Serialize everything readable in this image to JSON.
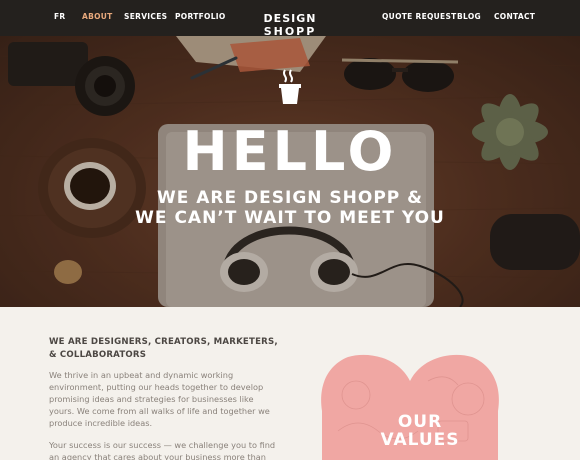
{
  "nav": {
    "left_items": [
      {
        "label": "FR",
        "active": false
      },
      {
        "label": "ABOUT",
        "active": true
      },
      {
        "label": "SERVICES",
        "active": false
      },
      {
        "label": "PORTFOLIO",
        "active": false
      }
    ],
    "right_items": [
      {
        "label": "QUOTE REQUEST"
      },
      {
        "label": "BLOG"
      },
      {
        "label": "CONTACT"
      }
    ],
    "logo": {
      "line1": "DESIGN",
      "line2": "SHOPP"
    }
  },
  "hero": {
    "title": "HELLO",
    "subtitle_line1": "WE ARE DESIGN SHOPP &",
    "subtitle_line2": "WE CAN’T WAIT TO MEET YOU",
    "icon": "coffee-cup-icon"
  },
  "about": {
    "heading": "WE ARE DESIGNERS, CREATORS, MARKETERS, & COLLABORATORS",
    "paragraph1": "We thrive in an upbeat and dynamic working environment, putting our heads together to develop promising ideas and strategies for businesses like yours. We come from all walks of life and together we produce incredible ideas.",
    "paragraph2": "Your success is our success — we challenge you to find an agency that cares about your business more than we"
  },
  "values": {
    "line1": "OUR",
    "line2": "VALUES"
  },
  "colors": {
    "nav_bg": "#24211e",
    "nav_active": "#e8a97c",
    "page_bg": "#f4f1ec",
    "heart_pink": "#f0a7a3",
    "heading_text": "#4c4743",
    "body_text": "#8a827b"
  }
}
